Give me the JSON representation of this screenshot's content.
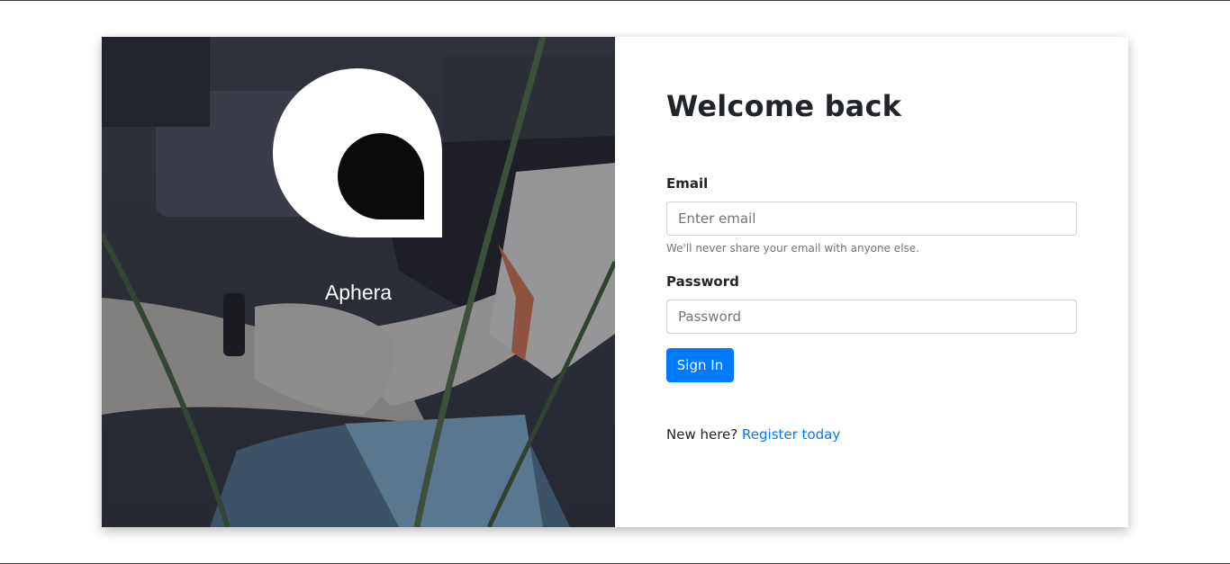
{
  "brand": {
    "name": "Aphera",
    "logo_icon": "aphera-logo-icon"
  },
  "login": {
    "title": "Welcome back",
    "email_label": "Email",
    "email_placeholder": "Enter email",
    "email_value": "",
    "email_help": "We'll never share your email with anyone else.",
    "password_label": "Password",
    "password_placeholder": "Password",
    "password_value": "",
    "submit_label": "Sign In",
    "register_prompt": "New here?",
    "register_link": "Register today"
  },
  "colors": {
    "primary": "#007bff",
    "text": "#212529",
    "muted": "#6c757d",
    "overlay": "#2b2d34"
  }
}
